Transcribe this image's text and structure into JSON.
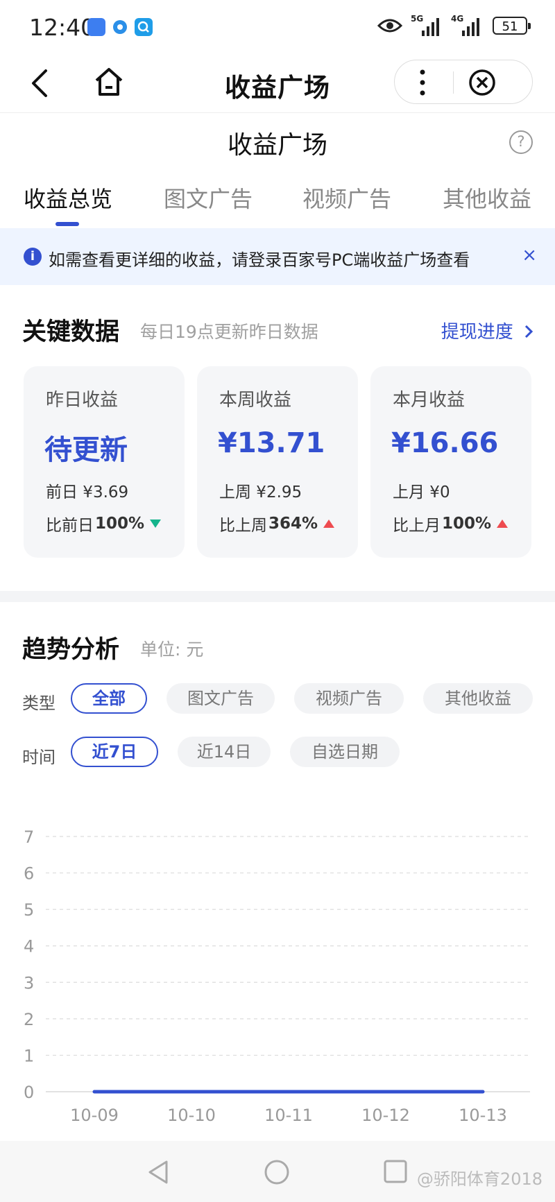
{
  "status_bar": {
    "time": "12:40",
    "signal_1_label": "5G",
    "signal_2_label": "4G",
    "battery": "51"
  },
  "nav": {
    "title": "收益广场"
  },
  "page": {
    "title": "收益广场",
    "help": "?"
  },
  "tabs": [
    {
      "label": "收益总览"
    },
    {
      "label": "图文广告"
    },
    {
      "label": "视频广告"
    },
    {
      "label": "其他收益"
    }
  ],
  "notice": {
    "text": "如需查看更详细的收益，请登录百家号PC端收益广场查看",
    "close": "×",
    "icon": "i"
  },
  "key_data": {
    "title": "关键数据",
    "subtitle": "每日19点更新昨日数据",
    "link": "提现进度",
    "cards": [
      {
        "label": "昨日收益",
        "value": "待更新",
        "prev": "前日 ¥3.69",
        "ratio_label": "比前日",
        "ratio": "100%",
        "trend": "down"
      },
      {
        "label": "本周收益",
        "value": "¥13.71",
        "prev": "上周 ¥2.95",
        "ratio_label": "比上周",
        "ratio": "364%",
        "trend": "up"
      },
      {
        "label": "本月收益",
        "value": "¥16.66",
        "prev": "上月 ¥0",
        "ratio_label": "比上月",
        "ratio": "100%",
        "trend": "up"
      }
    ]
  },
  "trend": {
    "title": "趋势分析",
    "subtitle": "单位: 元",
    "type_label": "类型",
    "type_options": [
      "全部",
      "图文广告",
      "视频广告",
      "其他收益"
    ],
    "type_selected": "全部",
    "time_label": "时间",
    "time_options": [
      "近7日",
      "近14日",
      "自选日期"
    ],
    "time_selected": "近7日"
  },
  "chart_data": {
    "type": "line",
    "x": [
      "10-09",
      "10-10",
      "10-11",
      "10-12",
      "10-13"
    ],
    "series": [
      {
        "values": [
          0,
          0,
          0,
          0,
          0
        ]
      }
    ],
    "yticks": [
      0,
      1,
      2,
      3,
      4,
      5,
      6,
      7
    ],
    "ylim": [
      0,
      7
    ],
    "grid": true
  },
  "watermark": "@骄阳体育2018",
  "colors": {
    "accent": "#3350d0",
    "down": "#14b48c",
    "up": "#ee4b50"
  }
}
